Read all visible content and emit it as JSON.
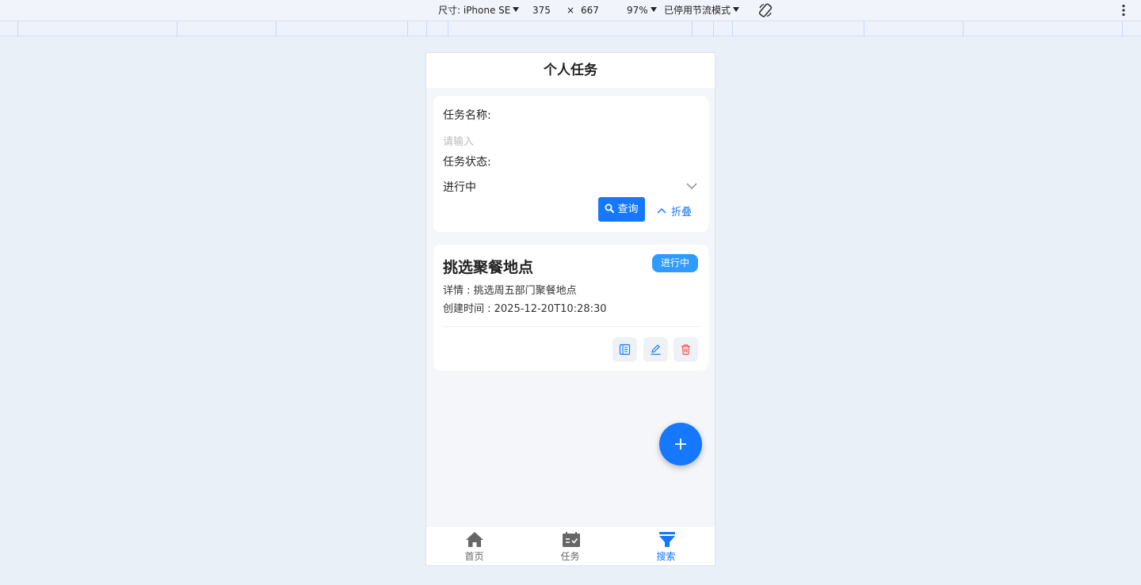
{
  "devtools": {
    "dimensions_label": "尺寸: iPhone SE",
    "width": "375",
    "times": "×",
    "height": "667",
    "zoom": "97%",
    "throttle": "已停用节流模式"
  },
  "page": {
    "title": "个人任务"
  },
  "search": {
    "name_label": "任务名称:",
    "name_placeholder": "请输入",
    "status_label": "任务状态:",
    "status_value": "进行中",
    "query_button": "查询",
    "fold_button": "折叠"
  },
  "tasks": [
    {
      "title": "挑选聚餐地点",
      "status": "进行中",
      "detail": "详情 : 挑选周五部门聚餐地点",
      "created": "创建时间 : 2025-12-20T10:28:30"
    }
  ],
  "tabbar": {
    "items": [
      {
        "label": "首页",
        "icon": "home-icon",
        "active": false
      },
      {
        "label": "任务",
        "icon": "task-icon",
        "active": false
      },
      {
        "label": "搜索",
        "icon": "search-funnel-icon",
        "active": true
      }
    ]
  },
  "colors": {
    "primary": "#1677ff",
    "badge": "#2f9bff",
    "danger": "#ff4d4f",
    "tab_inactive": "#666666"
  }
}
